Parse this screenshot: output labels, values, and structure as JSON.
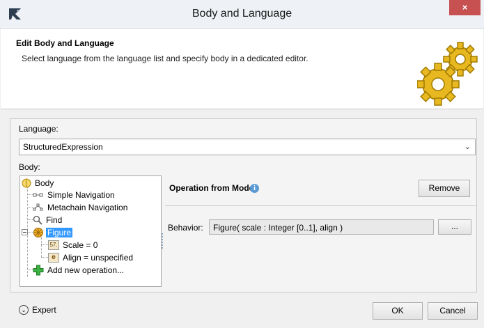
{
  "window": {
    "title": "Body and Language",
    "close_glyph": "×"
  },
  "banner": {
    "title": "Edit Body and Language",
    "description": "Select language from the language list and specify body in a dedicated editor.",
    "illustration_icon": "gears-icon"
  },
  "language": {
    "label": "Language:",
    "value": "StructuredExpression"
  },
  "body": {
    "label": "Body:",
    "tree": {
      "root": "Body",
      "items": [
        "Simple Navigation",
        "Metachain Navigation",
        "Find",
        "Figure"
      ],
      "figure_children": [
        "Scale = 0",
        "Align = unspecified"
      ],
      "add_label": "Add new operation...",
      "selected": "Figure",
      "icons": {
        "root": "body-icon",
        "simple_navigation": "simple-navigation-icon",
        "metachain_navigation": "metachain-icon",
        "find": "magnifier-icon",
        "figure": "figure-icon",
        "scale": "number-icon",
        "scale_glyph": "57.",
        "align": "enumeration-icon",
        "align_glyph": "e",
        "add": "plus-icon"
      }
    }
  },
  "operation": {
    "title": "Operation from Model",
    "info_glyph": "i",
    "remove_label": "Remove",
    "behavior_label": "Behavior:",
    "behavior_value": "Figure( scale : Integer [0..1], align )",
    "browse_label": "..."
  },
  "footer": {
    "expert_label": "Expert",
    "ok_label": "OK",
    "cancel_label": "Cancel"
  },
  "colors": {
    "selection": "#3399ff",
    "close_button": "#c75050",
    "info": "#5b9bd5",
    "add_green": "#3cb043"
  }
}
